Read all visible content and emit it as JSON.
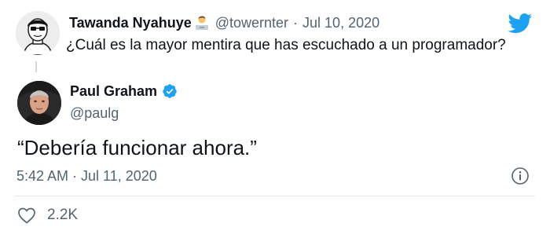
{
  "reply_context": {
    "name": "Tawanda Nyahuye",
    "handle": "@towernter",
    "date": "Jul 10, 2020",
    "separator": "·",
    "text": "¿Cuál es la mayor mentira que has escuchado a un programador?"
  },
  "tweet": {
    "author_name": "Paul Graham",
    "author_handle": "@paulg",
    "text": "“Debería funcionar ahora.”",
    "timestamp": "5:42 AM · Jul 11, 2020",
    "likes": "2.2K"
  },
  "icons": {
    "brand": "twitter-bird-icon",
    "verified": "verified-badge-icon",
    "info": "info-icon",
    "like": "heart-icon",
    "emoji": "technologist-emoji-icon"
  },
  "colors": {
    "twitter_blue": "#1DA1F2",
    "secondary_text": "#536471",
    "primary_text": "#0F1419"
  }
}
